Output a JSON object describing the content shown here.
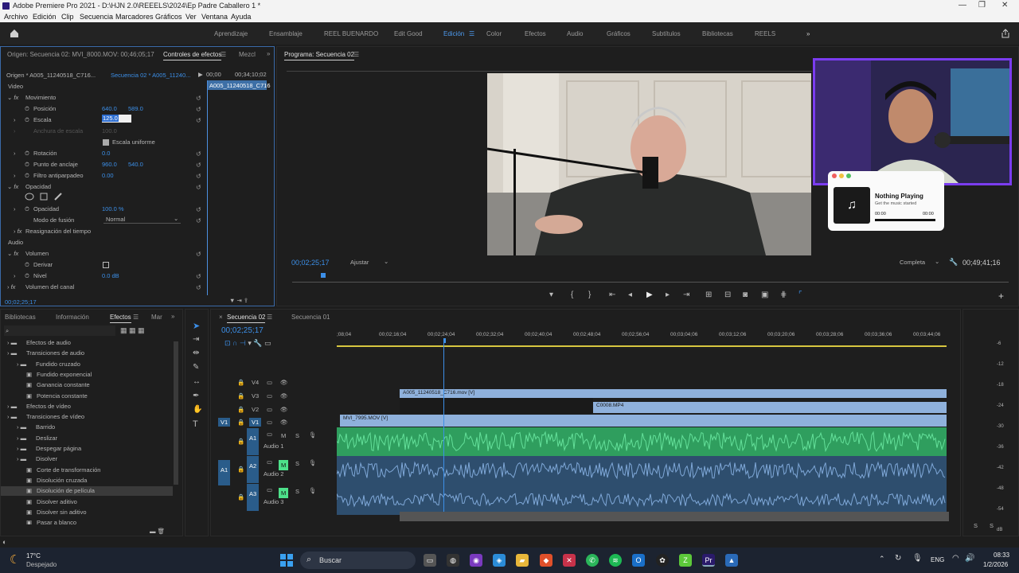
{
  "window": {
    "title": "Adobe Premiere Pro 2021 - D:\\HJN 2.0\\REEELS\\2024\\Ep Padre Caballero 1 *",
    "controls": [
      "—",
      "❐",
      "✕"
    ]
  },
  "menu": [
    "Archivo",
    "Edición",
    "Clip",
    "Secuencia",
    "Marcadores",
    "Gráficos",
    "Ver",
    "Ventana",
    "Ayuda"
  ],
  "workspaces": [
    "Aprendizaje",
    "Ensamblaje",
    "REEL BUENARDO",
    "Edit Good",
    "Edición",
    "Color",
    "Efectos",
    "Audio",
    "Gráficos",
    "Subtítulos",
    "Bibliotecas",
    "REELS"
  ],
  "workspace_active": "Edición",
  "effect_controls": {
    "tab_source": "Origen: Secuencia 02: MVI_8000.MOV: 00;46;05;17",
    "tab_active": "Controles de efectos",
    "tab_mixer": "Mezcl",
    "clip_origin": "Origen * A005_11240518_C716...",
    "clip_sequence": "Secuencia 02 * A005_11240...",
    "time_start": "00;00",
    "time_end": "00;34;10;02",
    "mini_clip": "A005_11240518_C716",
    "section_video": "Video",
    "movimiento": "Movimiento",
    "posicion_label": "Posición",
    "posicion_x": "640.0",
    "posicion_y": "589.0",
    "escala_label": "Escala",
    "escala_value": "125.0",
    "anchura_label": "Anchura de escala",
    "anchura_value": "100.0",
    "uniforme_label": "Escala uniforme",
    "rotacion_label": "Rotación",
    "rotacion_value": "0.0",
    "anclaje_label": "Punto de anclaje",
    "anclaje_x": "960.0",
    "anclaje_y": "540.0",
    "filtro_label": "Filtro antiparpadeo",
    "filtro_value": "0.00",
    "opacidad_section": "Opacidad",
    "opacidad_label": "Opacidad",
    "opacidad_value": "100.0 %",
    "fusion_label": "Modo de fusión",
    "fusion_value": "Normal",
    "reasignacion": "Reasignación del tiempo",
    "section_audio": "Audio",
    "volumen": "Volumen",
    "derivar_label": "Derivar",
    "nivel_label": "Nivel",
    "nivel_value": "0.0 dB",
    "volumen_canal": "Volumen del canal",
    "timecode": "00;02;25;17"
  },
  "program": {
    "tab": "Programa: Secuencia 02",
    "timecode": "00;02;25;17",
    "fit": "Ajustar",
    "quality": "Completa",
    "duration": "00;49;41;16"
  },
  "project": {
    "tabs": [
      "Bibliotecas",
      "Información",
      "Efectos",
      "Mar"
    ],
    "active_tab": "Efectos",
    "tree": [
      {
        "label": "Efectos de audio",
        "indent": 0,
        "type": "folder"
      },
      {
        "label": "Transiciones de audio",
        "indent": 0,
        "type": "folder"
      },
      {
        "label": "Fundido cruzado",
        "indent": 1,
        "type": "folder"
      },
      {
        "label": "Fundido exponencial",
        "indent": 2,
        "type": "fx"
      },
      {
        "label": "Ganancia constante",
        "indent": 2,
        "type": "fx"
      },
      {
        "label": "Potencia constante",
        "indent": 2,
        "type": "fx"
      },
      {
        "label": "Efectos de vídeo",
        "indent": 0,
        "type": "folder"
      },
      {
        "label": "Transiciones de vídeo",
        "indent": 0,
        "type": "folder"
      },
      {
        "label": "Barrido",
        "indent": 1,
        "type": "folder"
      },
      {
        "label": "Deslizar",
        "indent": 1,
        "type": "folder"
      },
      {
        "label": "Despegar página",
        "indent": 1,
        "type": "folder"
      },
      {
        "label": "Disolver",
        "indent": 1,
        "type": "folder"
      },
      {
        "label": "Corte de transformación",
        "indent": 2,
        "type": "fx"
      },
      {
        "label": "Disolución cruzada",
        "indent": 2,
        "type": "fx"
      },
      {
        "label": "Disolución de película",
        "indent": 2,
        "type": "fx"
      },
      {
        "label": "Disolver aditivo",
        "indent": 2,
        "type": "fx"
      },
      {
        "label": "Disolver sin aditivo",
        "indent": 2,
        "type": "fx"
      },
      {
        "label": "Pasar a blanco",
        "indent": 2,
        "type": "fx"
      }
    ],
    "selected": "Disolución de película"
  },
  "timeline": {
    "tabs": [
      "Secuencia 02",
      "Secuencia 01"
    ],
    "timecode": "00;02;25;17",
    "ruler": [
      ";08;04",
      "00;02;16;04",
      "00;02;24;04",
      "00;02;32;04",
      "00;02;40;04",
      "00;02;48;04",
      "00;02;56;04",
      "00;03;04;06",
      "00;03;12;06",
      "00;03;20;06",
      "00;03;28;06",
      "00;03;36;06",
      "00;03;44;06"
    ],
    "video_tracks": [
      "V4",
      "V3",
      "V2",
      "V1"
    ],
    "audio_tracks": [
      "A1",
      "A2",
      "A3"
    ],
    "audio_names": [
      "Audio 1",
      "Audio 2",
      "Audio 3"
    ],
    "clips": {
      "v3": "A005_11240518_C716.mov [V]",
      "v2": "C0008.MP4",
      "v1": "MVI_7995.MOV [V]"
    },
    "meter_labels": [
      "-6",
      "-12",
      "-18",
      "-24",
      "-30",
      "-36",
      "-42",
      "-48",
      "-54",
      "dB"
    ],
    "solo_labels": [
      "S",
      "S"
    ]
  },
  "overlay": {
    "now_playing_title": "Nothing Playing",
    "now_playing_sub": "Get the music started",
    "t_start": "00:00",
    "t_end": "00:00"
  },
  "taskbar": {
    "weather_temp": "17°C",
    "weather_desc": "Despejado",
    "search": "Buscar",
    "lang": "ENG",
    "time": "08:33",
    "date": "1/2/2026"
  }
}
